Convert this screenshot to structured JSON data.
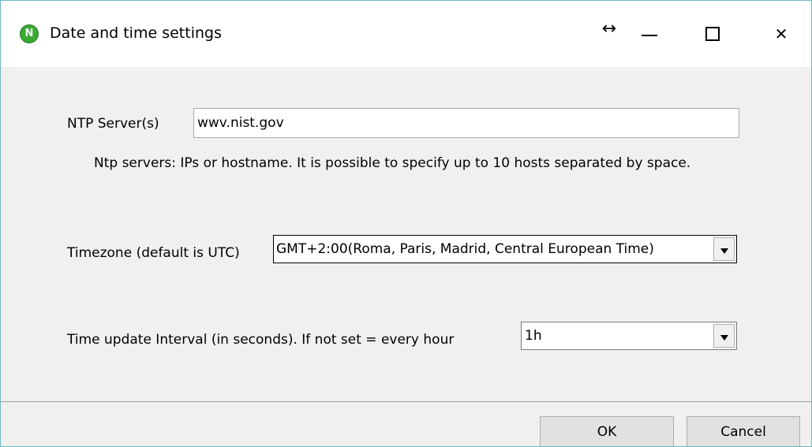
{
  "window": {
    "title": "Date and time settings",
    "app_icon_letter": "N",
    "controls": {
      "resize_glyph": "↔",
      "minimize_icon": "minimize-icon",
      "maximize_icon": "maximize-icon",
      "close_glyph": "✕"
    }
  },
  "form": {
    "ntp": {
      "label": "NTP Server(s)",
      "value": "wwv.nist.gov",
      "hint": "Ntp servers: IPs or hostname. It is possible to specify up to 10 hosts separated by space."
    },
    "timezone": {
      "label": "Timezone (default is UTC)",
      "selected": "GMT+2:00(Roma, Paris, Madrid, Central European Time)"
    },
    "interval": {
      "label": "Time update Interval (in seconds). If not set = every hour",
      "selected": "1h"
    }
  },
  "footer": {
    "ok_label": "OK",
    "cancel_label": "Cancel"
  },
  "colors": {
    "window_border": "#6fb6c7",
    "app_icon": "#3aa935",
    "background": "#f0f0f0"
  }
}
